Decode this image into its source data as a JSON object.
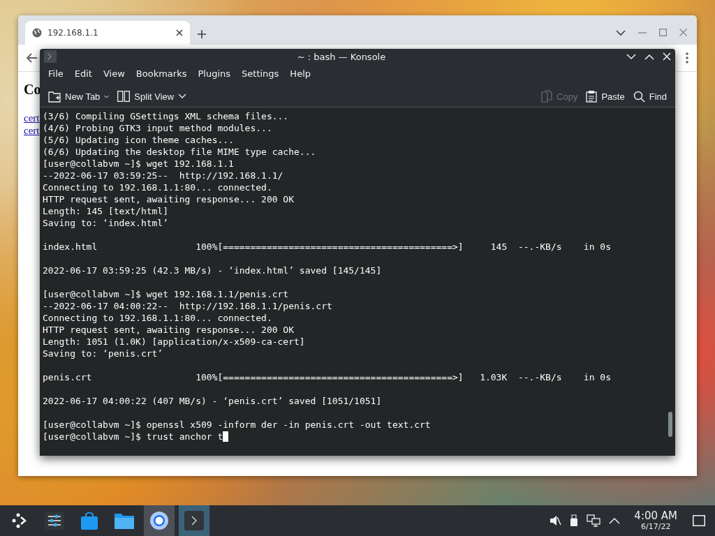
{
  "browser": {
    "tab": {
      "title": "192.168.1.1",
      "selected": true
    },
    "page_heading": "Co",
    "links": [
      "cert",
      "cert"
    ]
  },
  "konsole": {
    "title": "~ : bash — Konsole",
    "menu": [
      "File",
      "Edit",
      "View",
      "Bookmarks",
      "Plugins",
      "Settings",
      "Help"
    ],
    "toolbar": [
      {
        "kind": "new-tab",
        "label": "New Tab",
        "disabled": false
      },
      {
        "kind": "split-view",
        "label": "Split View",
        "disabled": false
      },
      {
        "kind": "copy",
        "label": "Copy",
        "disabled": true
      },
      {
        "kind": "paste",
        "label": "Paste",
        "disabled": false
      },
      {
        "kind": "find",
        "label": "Find",
        "disabled": false
      }
    ],
    "terminal": {
      "blocks": [
        [
          "(3/6) Compiling GSettings XML schema files...",
          "(4/6) Probing GTK3 input method modules...",
          "(5/6) Updating icon theme caches...",
          "(6/6) Updating the desktop file MIME type cache...",
          "[user@collabvm ~]$ wget 192.168.1.1",
          "--2022-06-17 03:59:25--  http://192.168.1.1/",
          "Connecting to 192.168.1.1:80... connected.",
          "HTTP request sent, awaiting response... 200 OK",
          "Length: 145 [text/html]",
          "Saving to: ‘index.html’"
        ],
        [
          "index.html                  100%[==========================================>]     145  --.-KB/s    in 0s"
        ],
        [
          "2022-06-17 03:59:25 (42.3 MB/s) - ‘index.html’ saved [145/145]"
        ],
        [
          "[user@collabvm ~]$ wget 192.168.1.1/penis.crt",
          "--2022-06-17 04:00:22--  http://192.168.1.1/penis.crt",
          "Connecting to 192.168.1.1:80... connected.",
          "HTTP request sent, awaiting response... 200 OK",
          "Length: 1051 (1.0K) [application/x-x509-ca-cert]",
          "Saving to: ‘penis.crt’"
        ],
        [
          "penis.crt                   100%[==========================================>]   1.03K  --.-KB/s    in 0s"
        ],
        [
          "2022-06-17 04:00:22 (407 MB/s) - ‘penis.crt’ saved [1051/1051]"
        ],
        [
          "[user@collabvm ~]$ openssl x509 -inform der -in penis.crt -out text.crt",
          "[user@collabvm ~]$ trust anchor t"
        ]
      ],
      "cursor": true
    }
  },
  "taskbar": {
    "apps": [
      {
        "kind": "launcher",
        "running": false,
        "focused": false
      },
      {
        "kind": "settings",
        "running": false,
        "focused": false
      },
      {
        "kind": "store",
        "running": false,
        "focused": false
      },
      {
        "kind": "files",
        "running": false,
        "focused": false
      },
      {
        "kind": "browser",
        "running": true,
        "focused": false
      },
      {
        "kind": "terminal",
        "running": true,
        "focused": true
      }
    ],
    "tray": [
      {
        "kind": "muted"
      },
      {
        "kind": "usb"
      },
      {
        "kind": "network"
      },
      {
        "kind": "expand"
      }
    ],
    "clock": {
      "time": "4:00 AM",
      "date": "6/17/22"
    }
  }
}
